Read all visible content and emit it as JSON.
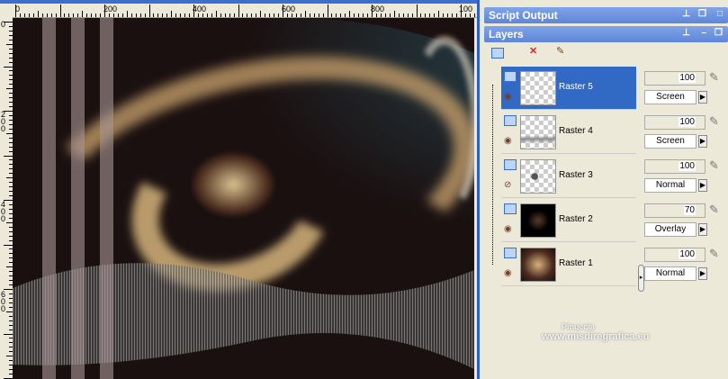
{
  "rulers": {
    "horizontal": [
      "0",
      "200",
      "400",
      "600",
      "800",
      "100"
    ],
    "vertical": [
      "0",
      "200",
      "400",
      "600"
    ]
  },
  "panels": {
    "script_output": "Script Output",
    "layers": "Layers"
  },
  "layers": [
    {
      "name": "Raster 5",
      "opacity": "100",
      "blend": "Screen",
      "visible": true,
      "selected": true
    },
    {
      "name": "Raster 4",
      "opacity": "100",
      "blend": "Screen",
      "visible": true,
      "selected": false
    },
    {
      "name": "Raster 3",
      "opacity": "100",
      "blend": "Normal",
      "visible": false,
      "selected": false
    },
    {
      "name": "Raster 2",
      "opacity": "70",
      "blend": "Overlay",
      "visible": true,
      "selected": false
    },
    {
      "name": "Raster 1",
      "opacity": "100",
      "blend": "Normal",
      "visible": true,
      "selected": false
    }
  ],
  "watermark": {
    "line1": "Pinuccia",
    "line2": "www.misdiregrafica.eu"
  },
  "colors": {
    "selection": "#316ac5",
    "titlebar": "#5f86d8"
  }
}
